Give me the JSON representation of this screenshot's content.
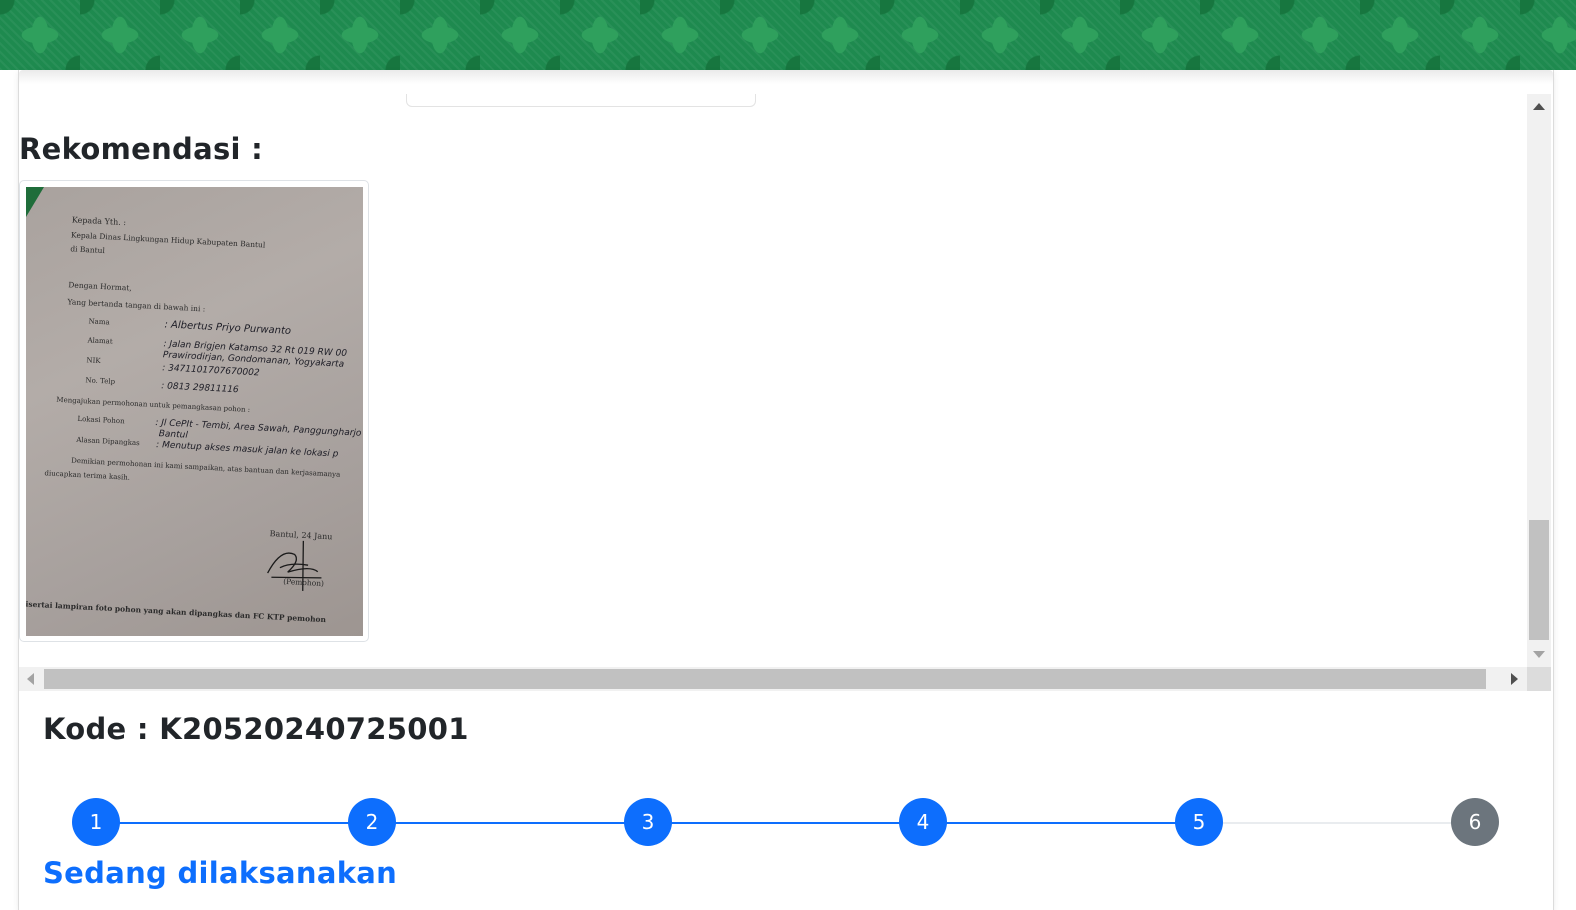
{
  "rekomendasi": {
    "title": "Rekomendasi :",
    "document": {
      "salutation": "Kepada Yth. :",
      "recipient": "Kepala Dinas Lingkungan Hidup Kabupaten Bantul",
      "place": "di Bantul",
      "greeting": "Dengan Hormat,",
      "intro": "Yang bertanda tangan di bawah ini :",
      "fields": [
        {
          "label": "Nama",
          "value": ": Albertus Priyo Purwanto"
        },
        {
          "label": "Alamat",
          "value": ": Jalan Brigjen Katamso 32 Rt 019 RW 00"
        },
        {
          "label": "",
          "value": "Prawirodirjan, Gondomanan, Yogyakarta"
        },
        {
          "label": "NIK",
          "value": ": 3471101707670002"
        },
        {
          "label": "No. Telp",
          "value": ": 0813 29811116"
        }
      ],
      "request": "Mengajukan permohonan untuk pemangkasan pohon :",
      "tree_fields": [
        {
          "label": "Lokasi Pohon",
          "value": ": Jl CePIt - Tembi, Area Sawah, Panggungharjo"
        },
        {
          "label": "",
          "value": "Bantul"
        },
        {
          "label": "Alasan Dipangkas",
          "value": ": Menutup akses masuk jalan ke lokasi p"
        }
      ],
      "closing_1": "Demikian permohonan ini kami sampaikan, atas bantuan dan kerjasamanya",
      "closing_2": "diucapkan terima kasih.",
      "date": "Bantul, 24 Janu",
      "signer": "(Pemohon)",
      "footnote": ": Disertai lampiran foto pohon yang akan dipangkas dan FC KTP pemohon"
    }
  },
  "kode": {
    "label": "Kode : K20520240725001"
  },
  "stepper": {
    "steps": [
      {
        "label": "1",
        "status": "done"
      },
      {
        "label": "2",
        "status": "done"
      },
      {
        "label": "3",
        "status": "done"
      },
      {
        "label": "4",
        "status": "done"
      },
      {
        "label": "5",
        "status": "done"
      },
      {
        "label": "6",
        "status": "pending"
      }
    ],
    "status_text": "Sedang dilaksanakan"
  },
  "colors": {
    "primary": "#0d6efd",
    "pending": "#6c757d",
    "header_green": "#1e8a4f"
  }
}
